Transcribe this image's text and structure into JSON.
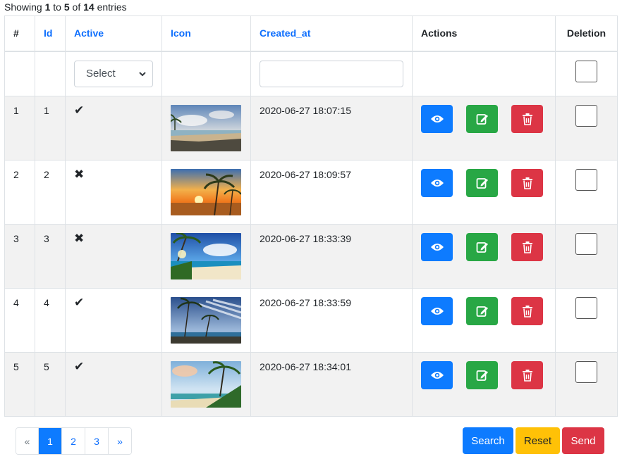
{
  "info": {
    "showing": "Showing",
    "from": "1",
    "to_word": "to",
    "to": "5",
    "of_word": "of",
    "total": "14",
    "entries": "entries"
  },
  "headers": {
    "num": "#",
    "id": "Id",
    "active": "Active",
    "icon": "Icon",
    "created_at": "Created_at",
    "actions": "Actions",
    "deletion": "Deletion"
  },
  "filters": {
    "active_select": "Select",
    "created_at_value": ""
  },
  "rows": [
    {
      "num": "1",
      "id": "1",
      "active": "✔",
      "created_at": "2020-06-27 18:07:15",
      "image": "beach with rocky shore and cloudy sky"
    },
    {
      "num": "2",
      "id": "2",
      "active": "✖",
      "created_at": "2020-06-27 18:09:57",
      "image": "palm trees at orange sunset"
    },
    {
      "num": "3",
      "id": "3",
      "active": "✖",
      "created_at": "2020-06-27 18:33:39",
      "image": "tropical beach with palms and blue sky"
    },
    {
      "num": "4",
      "id": "4",
      "active": "✔",
      "created_at": "2020-06-27 18:33:59",
      "image": "palm trees under dramatic blue clouds"
    },
    {
      "num": "5",
      "id": "5",
      "active": "✔",
      "created_at": "2020-06-27 18:34:01",
      "image": "palm trees on a sunny beach"
    }
  ],
  "pagination": {
    "prev": "«",
    "pages": [
      "1",
      "2",
      "3"
    ],
    "next": "»",
    "active_page": "1"
  },
  "buttons": {
    "search": "Search",
    "reset": "Reset",
    "send": "Send"
  },
  "colors": {
    "primary": "#0d7bff",
    "success": "#28a745",
    "danger": "#dc3545",
    "warning": "#ffc107",
    "link": "#0d6efd"
  }
}
